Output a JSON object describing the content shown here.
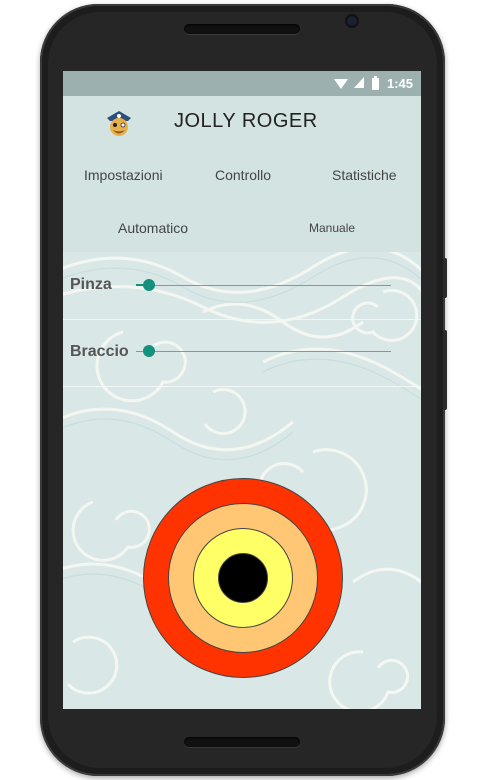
{
  "status_bar": {
    "time": "1:45"
  },
  "header": {
    "title": "JOLLY ROGER",
    "logo_icon": "pirate-logo-icon"
  },
  "tabs_top": [
    "Impostazioni",
    "Controllo",
    "Statistiche"
  ],
  "tabs_bottom": [
    "Automatico",
    "Manuale"
  ],
  "sliders": [
    {
      "label": "Pinza",
      "value": 0.02
    },
    {
      "label": "Braccio",
      "value": 0.0
    }
  ],
  "target": {
    "ring_colors": [
      "#ff3300",
      "#ffc773",
      "#ffff66",
      "#000000"
    ]
  },
  "colors": {
    "accent": "#14907e",
    "header_bg": "#d3e3e2",
    "status_bar_bg": "#9db0b0"
  }
}
